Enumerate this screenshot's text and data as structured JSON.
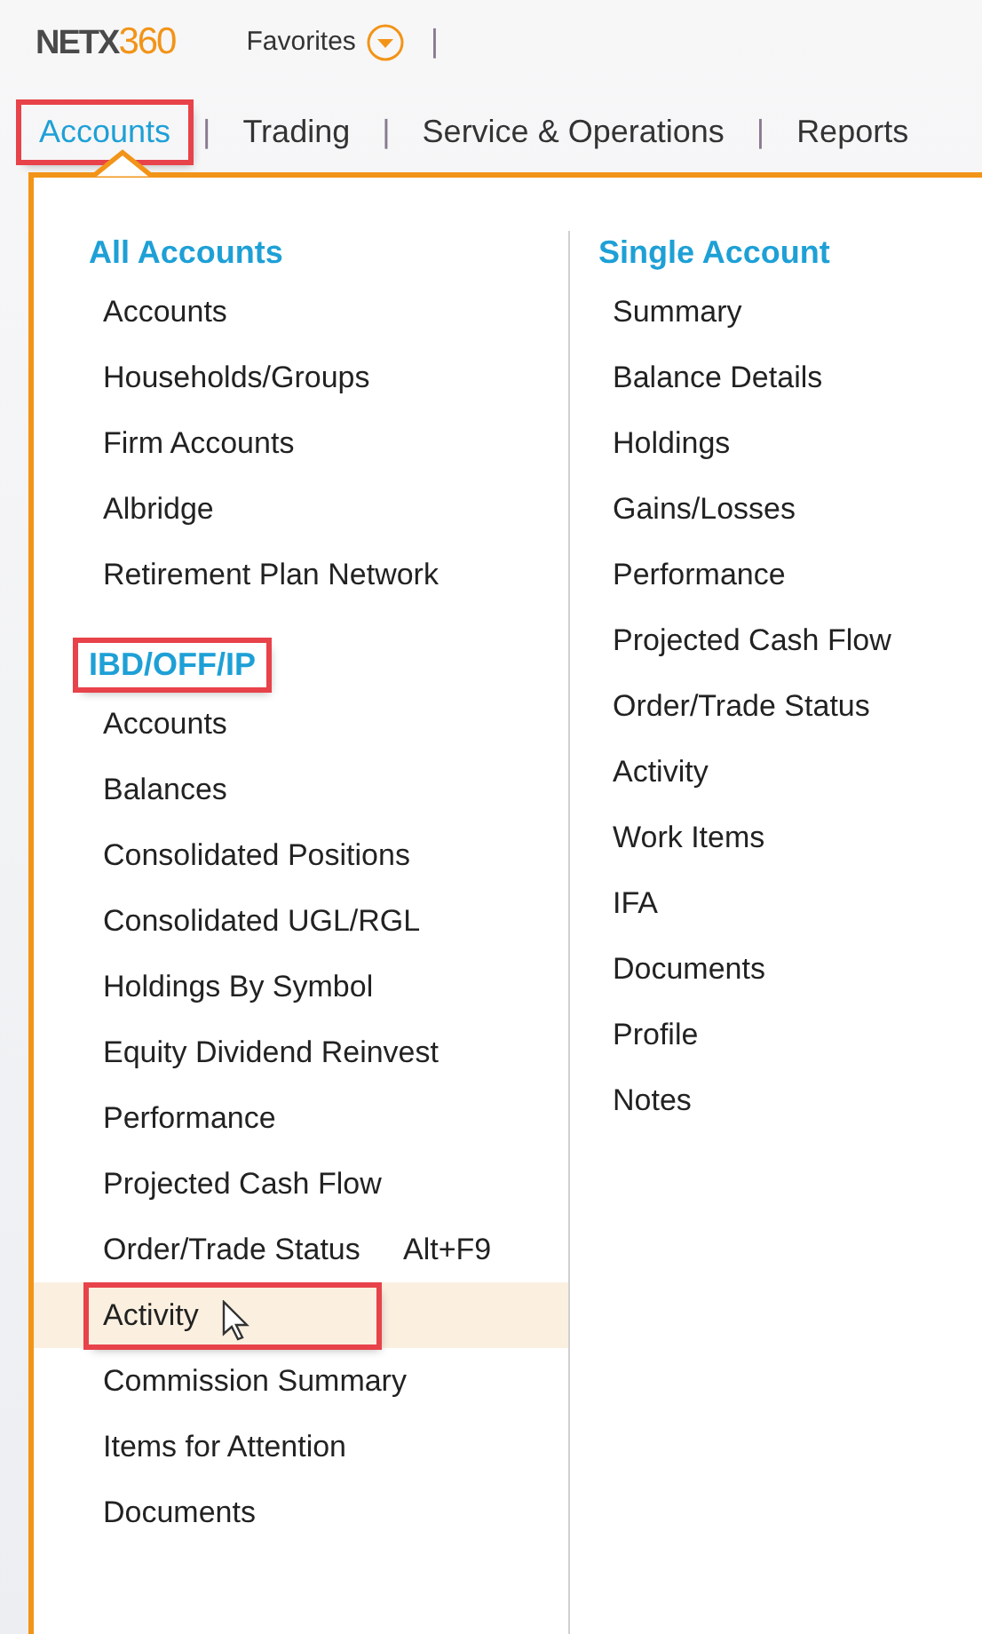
{
  "logo": {
    "prefix": "NETX",
    "suffix": "360"
  },
  "favorites": {
    "label": "Favorites",
    "separator": "|"
  },
  "nav": [
    {
      "label": "Accounts",
      "selected": true,
      "highlighted": true
    },
    {
      "separator": "|",
      "label": "Trading",
      "selected": false,
      "highlighted": false
    },
    {
      "separator": "|",
      "label": "Service & Operations",
      "selected": false,
      "highlighted": false
    },
    {
      "separator": "|",
      "label": "Reports",
      "selected": false,
      "highlighted": false
    }
  ],
  "menu": {
    "columns": [
      {
        "groups": [
          {
            "heading": "All Accounts",
            "highlighted": false,
            "items": [
              {
                "label": "Accounts",
                "hovered": false,
                "highlighted": false
              },
              {
                "label": "Households/Groups",
                "hovered": false,
                "highlighted": false
              },
              {
                "label": "Firm Accounts",
                "hovered": false,
                "highlighted": false
              },
              {
                "label": "Albridge",
                "hovered": false,
                "highlighted": false
              },
              {
                "label": "Retirement Plan Network",
                "hovered": false,
                "highlighted": false
              }
            ]
          },
          {
            "heading": "IBD/OFF/IP",
            "highlighted": true,
            "items": [
              {
                "label": "Accounts",
                "hovered": false,
                "highlighted": false
              },
              {
                "label": "Balances",
                "hovered": false,
                "highlighted": false
              },
              {
                "label": "Consolidated Positions",
                "hovered": false,
                "highlighted": false
              },
              {
                "label": "Consolidated UGL/RGL",
                "hovered": false,
                "highlighted": false
              },
              {
                "label": "Holdings By Symbol",
                "hovered": false,
                "highlighted": false
              },
              {
                "label": "Equity Dividend Reinvest",
                "hovered": false,
                "highlighted": false
              },
              {
                "label": "Performance",
                "hovered": false,
                "highlighted": false
              },
              {
                "label": "Projected Cash Flow",
                "hovered": false,
                "highlighted": false
              },
              {
                "label": "Order/Trade Status",
                "shortcut": "Alt+F9",
                "hovered": false,
                "highlighted": false
              },
              {
                "label": "Activity",
                "hovered": true,
                "highlighted": true
              },
              {
                "label": "Commission Summary",
                "hovered": false,
                "highlighted": false
              },
              {
                "label": "Items for Attention",
                "hovered": false,
                "highlighted": false
              },
              {
                "label": "Documents",
                "hovered": false,
                "highlighted": false
              }
            ]
          }
        ]
      },
      {
        "groups": [
          {
            "heading": "Single Account",
            "highlighted": false,
            "items": [
              {
                "label": "Summary",
                "hovered": false,
                "highlighted": false
              },
              {
                "label": "Balance Details",
                "hovered": false,
                "highlighted": false
              },
              {
                "label": "Holdings",
                "hovered": false,
                "highlighted": false
              },
              {
                "label": "Gains/Losses",
                "hovered": false,
                "highlighted": false
              },
              {
                "label": "Performance",
                "hovered": false,
                "highlighted": false
              },
              {
                "label": "Projected Cash Flow",
                "hovered": false,
                "highlighted": false
              },
              {
                "label": "Order/Trade Status",
                "hovered": false,
                "highlighted": false
              },
              {
                "label": "Activity",
                "hovered": false,
                "highlighted": false
              },
              {
                "label": "Work Items",
                "hovered": false,
                "highlighted": false
              },
              {
                "label": "IFA",
                "hovered": false,
                "highlighted": false
              },
              {
                "label": "Documents",
                "hovered": false,
                "highlighted": false
              },
              {
                "label": "Profile",
                "hovered": false,
                "highlighted": false
              },
              {
                "label": "Notes",
                "hovered": false,
                "highlighted": false
              }
            ]
          }
        ]
      }
    ]
  }
}
